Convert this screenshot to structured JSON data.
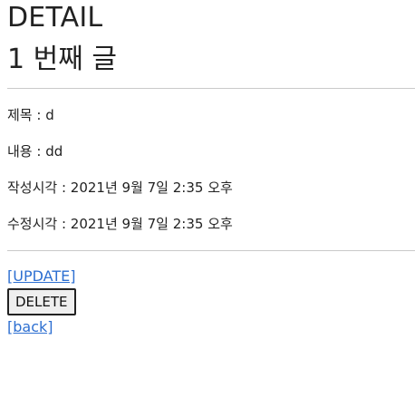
{
  "page": {
    "title": "DETAIL",
    "post_heading": "1 번째 글"
  },
  "fields": {
    "title_line": "제목 : d",
    "content_line": "내용 : dd",
    "created_line": "작성시각 : 2021년 9월 7일 2:35 오후",
    "modified_line": "수정시각 : 2021년 9월 7일 2:35 오후"
  },
  "actions": {
    "update_label": "[UPDATE]",
    "delete_label": "DELETE",
    "back_label": "[back]"
  },
  "colors": {
    "link": "#2d6fd1",
    "rule": "#c9c9c9",
    "button_bg": "#efefef"
  }
}
